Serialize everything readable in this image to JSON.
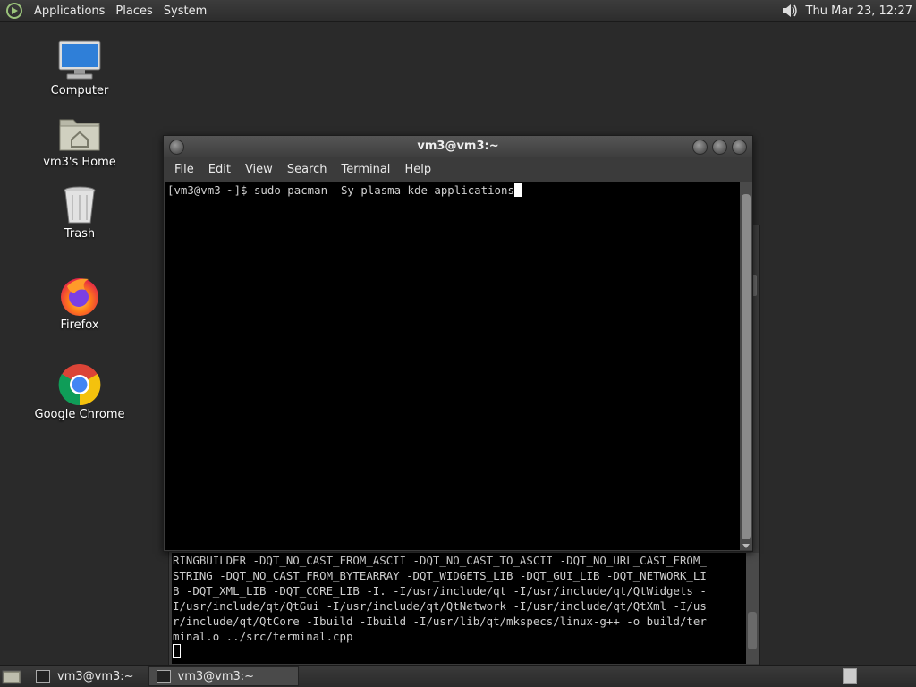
{
  "top_panel": {
    "menus": [
      "Applications",
      "Places",
      "System"
    ],
    "clock": "Thu Mar 23, 12:27"
  },
  "desktop_icons": [
    {
      "label": "Computer",
      "icon": "computer-icon"
    },
    {
      "label": "vm3's Home",
      "icon": "home-folder-icon"
    },
    {
      "label": "Trash",
      "icon": "trash-icon"
    },
    {
      "label": "Firefox",
      "icon": "firefox-icon"
    },
    {
      "label": "Google Chrome",
      "icon": "chrome-icon"
    }
  ],
  "terminal_window": {
    "title": "vm3@vm3:~",
    "menu": [
      "File",
      "Edit",
      "View",
      "Search",
      "Terminal",
      "Help"
    ],
    "prompt_line": "[vm3@vm3 ~]$ sudo pacman -Sy plasma kde-applications"
  },
  "background_terminal": {
    "lines": [
      "RINGBUILDER -DQT_NO_CAST_FROM_ASCII -DQT_NO_CAST_TO_ASCII -DQT_NO_URL_CAST_FROM_",
      "STRING -DQT_NO_CAST_FROM_BYTEARRAY -DQT_WIDGETS_LIB -DQT_GUI_LIB -DQT_NETWORK_LI",
      "B -DQT_XML_LIB -DQT_CORE_LIB -I. -I/usr/include/qt -I/usr/include/qt/QtWidgets -",
      "I/usr/include/qt/QtGui -I/usr/include/qt/QtNetwork -I/usr/include/qt/QtXml -I/us",
      "r/include/qt/QtCore -Ibuild -Ibuild -I/usr/lib/qt/mkspecs/linux-g++ -o build/ter",
      "minal.o ../src/terminal.cpp"
    ]
  },
  "taskbar": {
    "tasks": [
      {
        "label": "vm3@vm3:~",
        "active": false
      },
      {
        "label": "vm3@vm3:~",
        "active": true
      }
    ]
  }
}
